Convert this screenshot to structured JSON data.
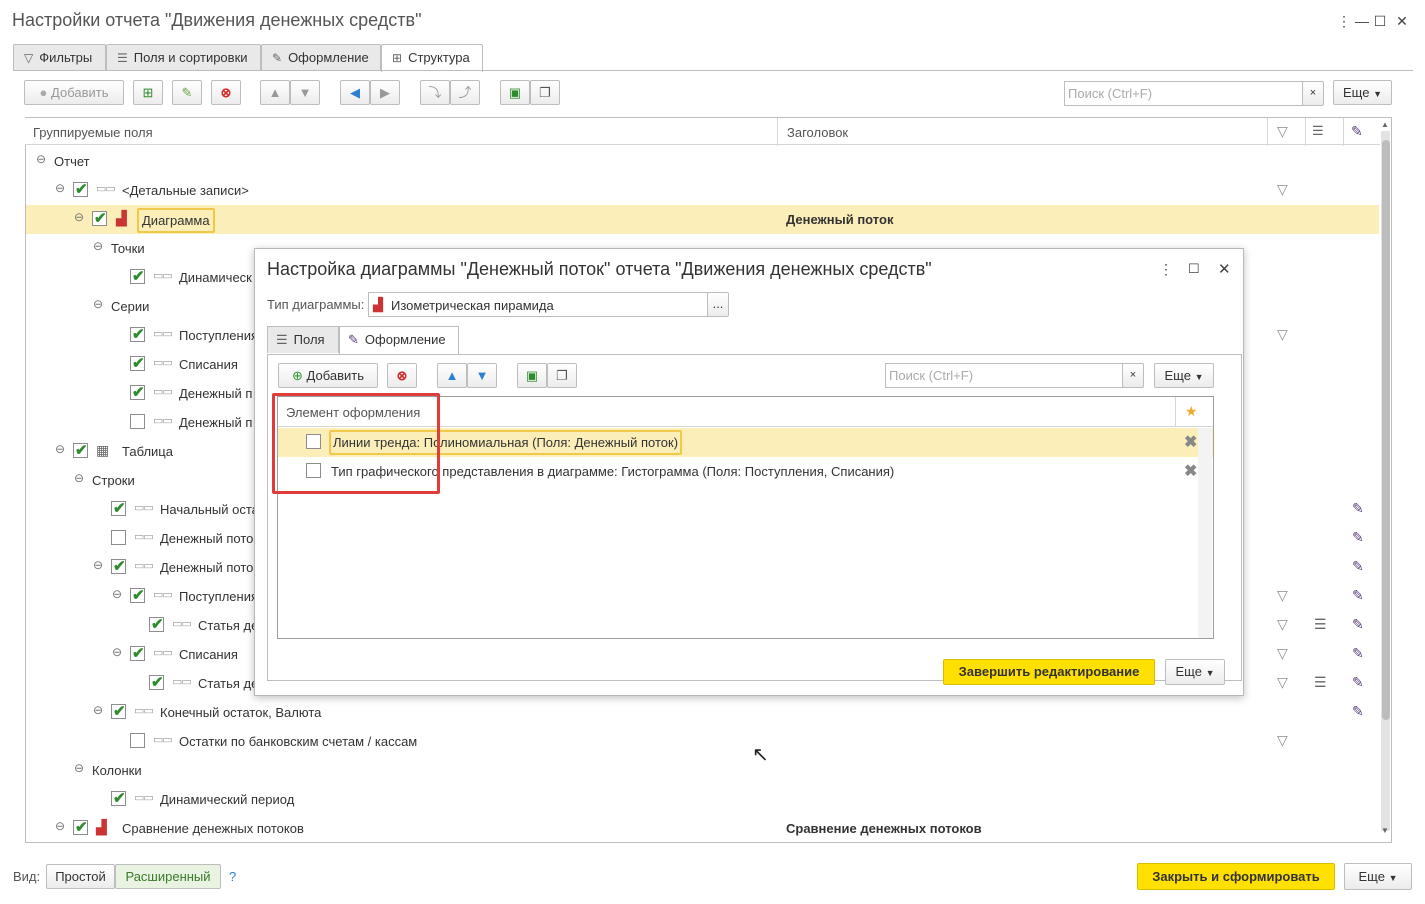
{
  "window": {
    "title": "Настройки отчета \"Движения денежных средств\"",
    "controls": [
      "⋮",
      "—",
      "☐",
      "✕"
    ]
  },
  "tabs": [
    {
      "label": "Фильтры",
      "icon": "filter-icon"
    },
    {
      "label": "Поля и сортировки",
      "icon": "fields-icon"
    },
    {
      "label": "Оформление",
      "icon": "brush-icon"
    },
    {
      "label": "Структура",
      "icon": "structure-icon"
    }
  ],
  "toolbar": {
    "add_label": "Добавить",
    "search_placeholder": "Поиск (Ctrl+F)",
    "more_label": "Еще"
  },
  "grid": {
    "col_fields": "Группируемые поля",
    "col_title": "Заголовок"
  },
  "rows": [
    {
      "label": "Отчет",
      "title": ""
    },
    {
      "label": "<Детальные записи>",
      "title": ""
    },
    {
      "label": "Диаграмма",
      "title": "Денежный поток"
    },
    {
      "label": "Точки",
      "title": ""
    },
    {
      "label": "Динамическ",
      "title": ""
    },
    {
      "label": "Серии",
      "title": ""
    },
    {
      "label": "Поступления",
      "title": ""
    },
    {
      "label": "Списания",
      "title": ""
    },
    {
      "label": "Денежный п",
      "title": ""
    },
    {
      "label": "Денежный п",
      "title": ""
    },
    {
      "label": "Таблица",
      "title": ""
    },
    {
      "label": "Строки",
      "title": ""
    },
    {
      "label": "Начальный оста",
      "title": ""
    },
    {
      "label": "Денежный пото",
      "title": ""
    },
    {
      "label": "Денежный пото",
      "title": ""
    },
    {
      "label": "Поступления",
      "title": ""
    },
    {
      "label": "Статья де",
      "title": ""
    },
    {
      "label": "Списания",
      "title": ""
    },
    {
      "label": "Статья де",
      "title": ""
    },
    {
      "label": "Конечный остаток, Валюта",
      "title": ""
    },
    {
      "label": "Остатки по банковским счетам / кассам",
      "title": ""
    },
    {
      "label": "Колонки",
      "title": ""
    },
    {
      "label": "Динамический период",
      "title": ""
    },
    {
      "label": "Сравнение денежных потоков",
      "title": "Сравнение денежных потоков"
    }
  ],
  "footer": {
    "view_label": "Вид:",
    "simple": "Простой",
    "advanced": "Расширенный",
    "help": "?",
    "close_generate": "Закрыть и сформировать",
    "more_label": "Еще"
  },
  "dialog": {
    "title": "Настройка диаграммы \"Денежный поток\" отчета \"Движения денежных средств\"",
    "type_label": "Тип диаграммы:",
    "type_value": "Изометрическая пирамида",
    "type_btn": "...",
    "tabs": [
      "Поля",
      "Оформление"
    ],
    "add_label": "Добавить",
    "search_placeholder": "Поиск (Ctrl+F)",
    "more_label": "Еще",
    "col_element": "Элемент оформления",
    "items": [
      "Линии тренда: Полиномиальная (Поля: Денежный поток)",
      "Тип графического представления в диаграмме: Гистограмма (Поля: Поступления, Списания)"
    ],
    "finish_label": "Завершить редактирование",
    "more_label2": "Еще"
  }
}
